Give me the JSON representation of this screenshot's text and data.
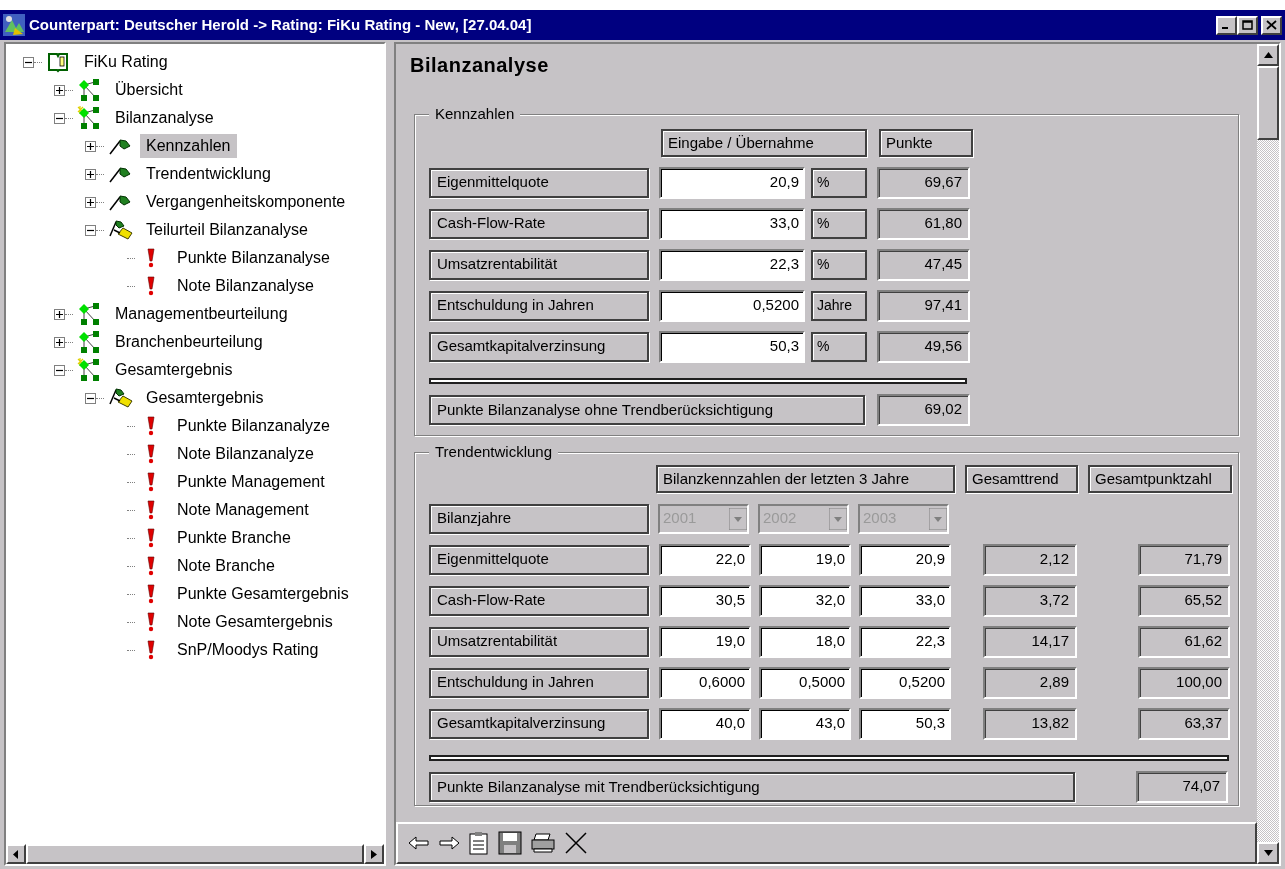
{
  "window": {
    "title": "Counterpart: Deutscher Herold -> Rating: FiKu Rating - New, [27.04.04]"
  },
  "tree": [
    {
      "label": "FiKu Rating",
      "kind": "book",
      "expanded": true,
      "selected": false,
      "children": [
        {
          "label": "Übersicht",
          "kind": "network",
          "expanded": false,
          "selected": false
        },
        {
          "label": "Bilanzanalyse",
          "kind": "network-active",
          "expanded": true,
          "selected": false,
          "children": [
            {
              "label": "Kennzahlen",
              "kind": "flag",
              "expanded": false,
              "selected": true
            },
            {
              "label": "Trendentwicklung",
              "kind": "flag",
              "expanded": false,
              "selected": false
            },
            {
              "label": "Vergangenheitskomponente",
              "kind": "flag",
              "expanded": false,
              "selected": false
            },
            {
              "label": "Teilurteil Bilanzanalyse",
              "kind": "flag-multi",
              "expanded": true,
              "selected": false,
              "children": [
                {
                  "label": "Punkte Bilanzanalyse",
                  "kind": "alert",
                  "selected": false
                },
                {
                  "label": "Note Bilanzanalyse",
                  "kind": "alert",
                  "selected": false
                }
              ]
            }
          ]
        },
        {
          "label": "Managementbeurteilung",
          "kind": "network",
          "expanded": false,
          "selected": false
        },
        {
          "label": "Branchenbeurteilung",
          "kind": "network",
          "expanded": false,
          "selected": false
        },
        {
          "label": "Gesamtergebnis",
          "kind": "network-active",
          "expanded": true,
          "selected": false,
          "children": [
            {
              "label": "Gesamtergebnis",
              "kind": "flag-multi",
              "expanded": true,
              "selected": false,
              "children": [
                {
                  "label": "Punkte Bilanzanalyze",
                  "kind": "alert",
                  "selected": false
                },
                {
                  "label": "Note Bilanzanalyze",
                  "kind": "alert",
                  "selected": false
                },
                {
                  "label": "Punkte Management",
                  "kind": "alert",
                  "selected": false
                },
                {
                  "label": "Note Management",
                  "kind": "alert",
                  "selected": false
                },
                {
                  "label": "Punkte Branche",
                  "kind": "alert",
                  "selected": false
                },
                {
                  "label": "Note Branche",
                  "kind": "alert",
                  "selected": false
                },
                {
                  "label": "Punkte Gesamtergebnis",
                  "kind": "alert",
                  "selected": false
                },
                {
                  "label": "Note Gesamtergebnis",
                  "kind": "alert",
                  "selected": false
                },
                {
                  "label": "SnP/Moodys Rating",
                  "kind": "alert",
                  "selected": false
                }
              ]
            }
          ]
        }
      ]
    }
  ],
  "form": {
    "heading": "Bilanzanalyse",
    "kennzahlen": {
      "title": "Kennzahlen",
      "headers": [
        "Eingabe / Übernahme",
        "Punkte"
      ],
      "rows": [
        {
          "label": "Eigenmittelquote",
          "value": "20,9",
          "unit": "%",
          "points": "69,67"
        },
        {
          "label": "Cash-Flow-Rate",
          "value": "33,0",
          "unit": "%",
          "points": "61,80"
        },
        {
          "label": "Umsatzrentabilität",
          "value": "22,3",
          "unit": "%",
          "points": "47,45"
        },
        {
          "label": "Entschuldung in Jahren",
          "value": "0,5200",
          "unit": "Jahre",
          "points": "97,41"
        },
        {
          "label": "Gesamtkapitalverzinsung",
          "value": "50,3",
          "unit": "%",
          "points": "49,56"
        }
      ],
      "summary": {
        "label": "Punkte Bilanzanalyse ohne Trendberücksichtigung",
        "points": "69,02"
      }
    },
    "trend": {
      "title": "Trendentwicklung",
      "headers": [
        "Bilanzkennzahlen der letzten 3 Jahre",
        "Gesamttrend",
        "Gesamtpunktzahl"
      ],
      "years": {
        "label": "Bilanzjahre",
        "options": [
          {
            "value": "2001",
            "disabled": true
          },
          {
            "value": "2002",
            "disabled": true
          },
          {
            "value": "2003",
            "disabled": true
          }
        ]
      },
      "rows": [
        {
          "label": "Eigenmittelquote",
          "values": [
            "22,0",
            "19,0",
            "20,9"
          ],
          "trend": "2,12",
          "total": "71,79"
        },
        {
          "label": "Cash-Flow-Rate",
          "values": [
            "30,5",
            "32,0",
            "33,0"
          ],
          "trend": "3,72",
          "total": "65,52"
        },
        {
          "label": "Umsatzrentabilität",
          "values": [
            "19,0",
            "18,0",
            "22,3"
          ],
          "trend": "14,17",
          "total": "61,62"
        },
        {
          "label": "Entschuldung in Jahren",
          "values": [
            "0,6000",
            "0,5000",
            "0,5200"
          ],
          "trend": "2,89",
          "total": "100,00"
        },
        {
          "label": "Gesamtkapitalverzinsung",
          "values": [
            "40,0",
            "43,0",
            "50,3"
          ],
          "trend": "13,82",
          "total": "63,37"
        }
      ],
      "summary": {
        "label": "Punkte Bilanzanalyse mit Trendberücksichtigung",
        "points": "74,07"
      }
    }
  }
}
